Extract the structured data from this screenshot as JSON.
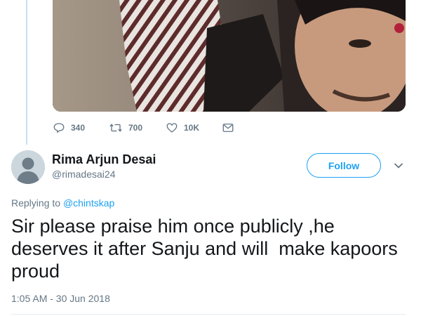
{
  "media": {
    "description_icon": "photo"
  },
  "actions": {
    "reply_count": "340",
    "retweet_count": "700",
    "like_count": "10K",
    "icons": [
      "reply-icon",
      "retweet-icon",
      "heart-icon",
      "mail-icon"
    ]
  },
  "author": {
    "name": "Rima Arjun Desai",
    "handle": "@rimadesai24"
  },
  "follow_label": "Follow",
  "replying": {
    "prefix": "Replying to",
    "mention": "@chintskap"
  },
  "tweet_text": "Sir please praise him once publicly ,he deserves it after Sanju and will  make kapoors proud",
  "timestamp": "1:05 AM - 30 Jun 2018",
  "colors": {
    "accent": "#1da1f2",
    "muted": "#657786",
    "text": "#14171a",
    "thread_line": "#c4e1f5"
  }
}
